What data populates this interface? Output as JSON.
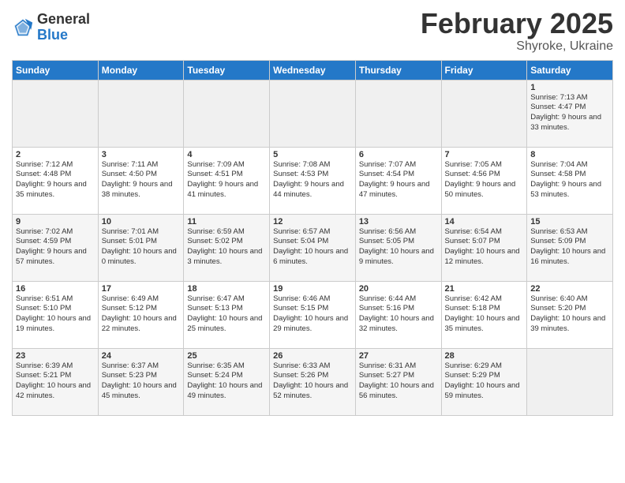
{
  "logo": {
    "general": "General",
    "blue": "Blue"
  },
  "header": {
    "month": "February 2025",
    "location": "Shyroke, Ukraine"
  },
  "weekdays": [
    "Sunday",
    "Monday",
    "Tuesday",
    "Wednesday",
    "Thursday",
    "Friday",
    "Saturday"
  ],
  "weeks": [
    [
      {
        "day": "",
        "info": ""
      },
      {
        "day": "",
        "info": ""
      },
      {
        "day": "",
        "info": ""
      },
      {
        "day": "",
        "info": ""
      },
      {
        "day": "",
        "info": ""
      },
      {
        "day": "",
        "info": ""
      },
      {
        "day": "1",
        "info": "Sunrise: 7:13 AM\nSunset: 4:47 PM\nDaylight: 9 hours and 33 minutes."
      }
    ],
    [
      {
        "day": "2",
        "info": "Sunrise: 7:12 AM\nSunset: 4:48 PM\nDaylight: 9 hours and 35 minutes."
      },
      {
        "day": "3",
        "info": "Sunrise: 7:11 AM\nSunset: 4:50 PM\nDaylight: 9 hours and 38 minutes."
      },
      {
        "day": "4",
        "info": "Sunrise: 7:09 AM\nSunset: 4:51 PM\nDaylight: 9 hours and 41 minutes."
      },
      {
        "day": "5",
        "info": "Sunrise: 7:08 AM\nSunset: 4:53 PM\nDaylight: 9 hours and 44 minutes."
      },
      {
        "day": "6",
        "info": "Sunrise: 7:07 AM\nSunset: 4:54 PM\nDaylight: 9 hours and 47 minutes."
      },
      {
        "day": "7",
        "info": "Sunrise: 7:05 AM\nSunset: 4:56 PM\nDaylight: 9 hours and 50 minutes."
      },
      {
        "day": "8",
        "info": "Sunrise: 7:04 AM\nSunset: 4:58 PM\nDaylight: 9 hours and 53 minutes."
      }
    ],
    [
      {
        "day": "9",
        "info": "Sunrise: 7:02 AM\nSunset: 4:59 PM\nDaylight: 9 hours and 57 minutes."
      },
      {
        "day": "10",
        "info": "Sunrise: 7:01 AM\nSunset: 5:01 PM\nDaylight: 10 hours and 0 minutes."
      },
      {
        "day": "11",
        "info": "Sunrise: 6:59 AM\nSunset: 5:02 PM\nDaylight: 10 hours and 3 minutes."
      },
      {
        "day": "12",
        "info": "Sunrise: 6:57 AM\nSunset: 5:04 PM\nDaylight: 10 hours and 6 minutes."
      },
      {
        "day": "13",
        "info": "Sunrise: 6:56 AM\nSunset: 5:05 PM\nDaylight: 10 hours and 9 minutes."
      },
      {
        "day": "14",
        "info": "Sunrise: 6:54 AM\nSunset: 5:07 PM\nDaylight: 10 hours and 12 minutes."
      },
      {
        "day": "15",
        "info": "Sunrise: 6:53 AM\nSunset: 5:09 PM\nDaylight: 10 hours and 16 minutes."
      }
    ],
    [
      {
        "day": "16",
        "info": "Sunrise: 6:51 AM\nSunset: 5:10 PM\nDaylight: 10 hours and 19 minutes."
      },
      {
        "day": "17",
        "info": "Sunrise: 6:49 AM\nSunset: 5:12 PM\nDaylight: 10 hours and 22 minutes."
      },
      {
        "day": "18",
        "info": "Sunrise: 6:47 AM\nSunset: 5:13 PM\nDaylight: 10 hours and 25 minutes."
      },
      {
        "day": "19",
        "info": "Sunrise: 6:46 AM\nSunset: 5:15 PM\nDaylight: 10 hours and 29 minutes."
      },
      {
        "day": "20",
        "info": "Sunrise: 6:44 AM\nSunset: 5:16 PM\nDaylight: 10 hours and 32 minutes."
      },
      {
        "day": "21",
        "info": "Sunrise: 6:42 AM\nSunset: 5:18 PM\nDaylight: 10 hours and 35 minutes."
      },
      {
        "day": "22",
        "info": "Sunrise: 6:40 AM\nSunset: 5:20 PM\nDaylight: 10 hours and 39 minutes."
      }
    ],
    [
      {
        "day": "23",
        "info": "Sunrise: 6:39 AM\nSunset: 5:21 PM\nDaylight: 10 hours and 42 minutes."
      },
      {
        "day": "24",
        "info": "Sunrise: 6:37 AM\nSunset: 5:23 PM\nDaylight: 10 hours and 45 minutes."
      },
      {
        "day": "25",
        "info": "Sunrise: 6:35 AM\nSunset: 5:24 PM\nDaylight: 10 hours and 49 minutes."
      },
      {
        "day": "26",
        "info": "Sunrise: 6:33 AM\nSunset: 5:26 PM\nDaylight: 10 hours and 52 minutes."
      },
      {
        "day": "27",
        "info": "Sunrise: 6:31 AM\nSunset: 5:27 PM\nDaylight: 10 hours and 56 minutes."
      },
      {
        "day": "28",
        "info": "Sunrise: 6:29 AM\nSunset: 5:29 PM\nDaylight: 10 hours and 59 minutes."
      },
      {
        "day": "",
        "info": ""
      }
    ]
  ]
}
